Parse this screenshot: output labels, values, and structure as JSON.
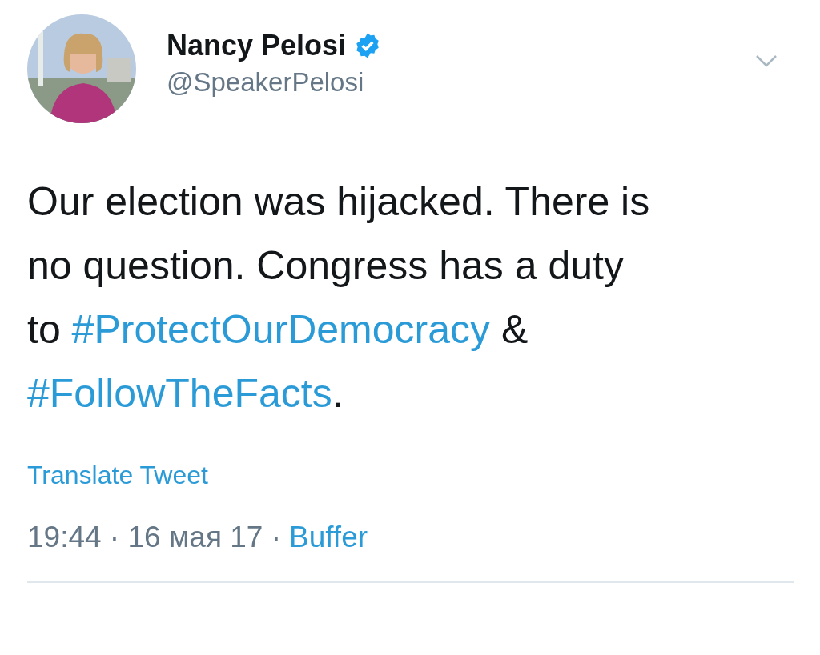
{
  "author": {
    "name": "Nancy Pelosi",
    "verified": true,
    "handle": "@SpeakerPelosi"
  },
  "tweet": {
    "segments": [
      {
        "kind": "text",
        "text": "Our election was hijacked. There is no question. Congress has a duty to "
      },
      {
        "kind": "hashtag",
        "text": "#ProtectOurDemocracy"
      },
      {
        "kind": "text",
        "text": " & "
      },
      {
        "kind": "hashtag",
        "text": "#FollowTheFacts"
      },
      {
        "kind": "text",
        "text": "."
      }
    ]
  },
  "translate": "Translate Tweet",
  "timestamp": "19:44 · 16 мая 17 ·",
  "source": "Buffer"
}
